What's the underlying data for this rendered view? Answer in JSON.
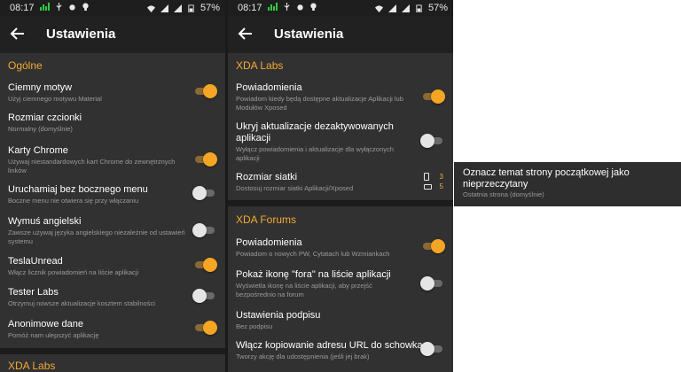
{
  "status_bar": {
    "left_time": "08:17",
    "right_time": "08:17",
    "battery": "57%"
  },
  "screen_left": {
    "title": "Ustawienia",
    "sections": [
      {
        "header": "Ogólne",
        "items": [
          {
            "title": "Ciemny motyw",
            "subtitle": "Użyj ciemnego motywu Material",
            "toggle": "on"
          },
          {
            "title": "Rozmiar czcionki",
            "subtitle": "Normalny (domyślnie)"
          },
          {
            "title": "Karty Chrome",
            "subtitle": "Używaj niestandardowych kart Chrome do zewnętrznych linków",
            "toggle": "on"
          },
          {
            "title": "Uruchamiaj bez bocznego menu",
            "subtitle": "Boczne menu nie otwiera się przy włączaniu",
            "toggle": "off"
          },
          {
            "title": "Wymuś angielski",
            "subtitle": "Zawsze używaj języka angielskiego niezależnie od ustawień systemu",
            "toggle": "off"
          },
          {
            "title": "TeslaUnread",
            "subtitle": "Włącz licznik powiadomień na liście aplikacji",
            "toggle": "on"
          },
          {
            "title": "Tester Labs",
            "subtitle": "Otrzymuj nowsze aktualizacje kosztem stabilności",
            "toggle": "off"
          },
          {
            "title": "Anonimowe dane",
            "subtitle": "Pomóż nam ulepszyć aplikację",
            "toggle": "on"
          }
        ]
      },
      {
        "header": "XDA Labs",
        "items": []
      }
    ]
  },
  "screen_right": {
    "title": "Ustawienia",
    "sections": [
      {
        "header": "XDA Labs",
        "items": [
          {
            "title": "Powiadomienia",
            "subtitle": "Powiadom kiedy będą dostępne aktualizacje Aplikacji lub Modułów Xposed",
            "toggle": "on"
          },
          {
            "title": "Ukryj aktualizacje dezaktywowanych aplikacji",
            "subtitle": "Wyłącz powiadomienia i aktualizacje dla wyłączonych aplikacji",
            "toggle": "off"
          },
          {
            "title": "Rozmiar siatki",
            "subtitle": "Dostosuj rozmiar siatki Aplikacji/Xposed",
            "grid_values": [
              "3",
              "5"
            ]
          }
        ]
      },
      {
        "header": "XDA Forums",
        "items": [
          {
            "title": "Powiadomienia",
            "subtitle": "Powiadom o nowych PW, Cytatach lub Wzmiankach",
            "toggle": "on"
          },
          {
            "title": "Pokaż ikonę \"fora\" na liście aplikacji",
            "subtitle": "Wyświetla ikonę na liście aplikacji, aby przejść bezpośrednio na forum",
            "toggle": "off"
          },
          {
            "title": "Ustawienia podpisu",
            "subtitle": "Bez podpisu"
          },
          {
            "title": "Włącz kopiowanie adresu URL do schowka",
            "subtitle": "Tworzy akcję dla udostępnienia (jeśli jej brak)",
            "toggle": "off"
          }
        ]
      }
    ]
  },
  "popup_item": {
    "title": "Oznacz temat strony początkowej jako nieprzeczytany",
    "subtitle": "Ostatnia strona (domyślnie)"
  },
  "colors": {
    "accent": "#f3a934",
    "background": "#313131",
    "appbar": "#212121"
  }
}
